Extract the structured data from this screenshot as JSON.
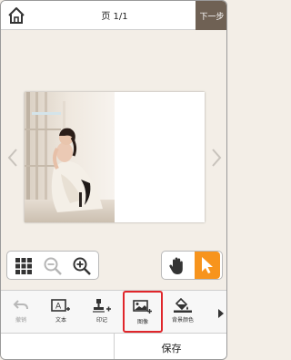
{
  "header": {
    "page_indicator": "页 1/1",
    "next_label": "下一步"
  },
  "toolbar": {
    "items": [
      {
        "icon": "undo-icon",
        "label": "撤销",
        "enabled": false
      },
      {
        "icon": "add-text-icon",
        "label": "文本",
        "enabled": true
      },
      {
        "icon": "add-stamp-icon",
        "label": "印记",
        "enabled": true
      },
      {
        "icon": "add-image-icon",
        "label": "图像",
        "enabled": true,
        "highlighted": true
      },
      {
        "icon": "background-color-icon",
        "label": "背景颜色",
        "enabled": true
      }
    ]
  },
  "footer": {
    "save_label": "保存"
  },
  "colors": {
    "accent": "#f7941d",
    "highlight": "#e0262b",
    "next_button_bg": "#6f6154",
    "canvas_bg": "#f3eee7"
  }
}
